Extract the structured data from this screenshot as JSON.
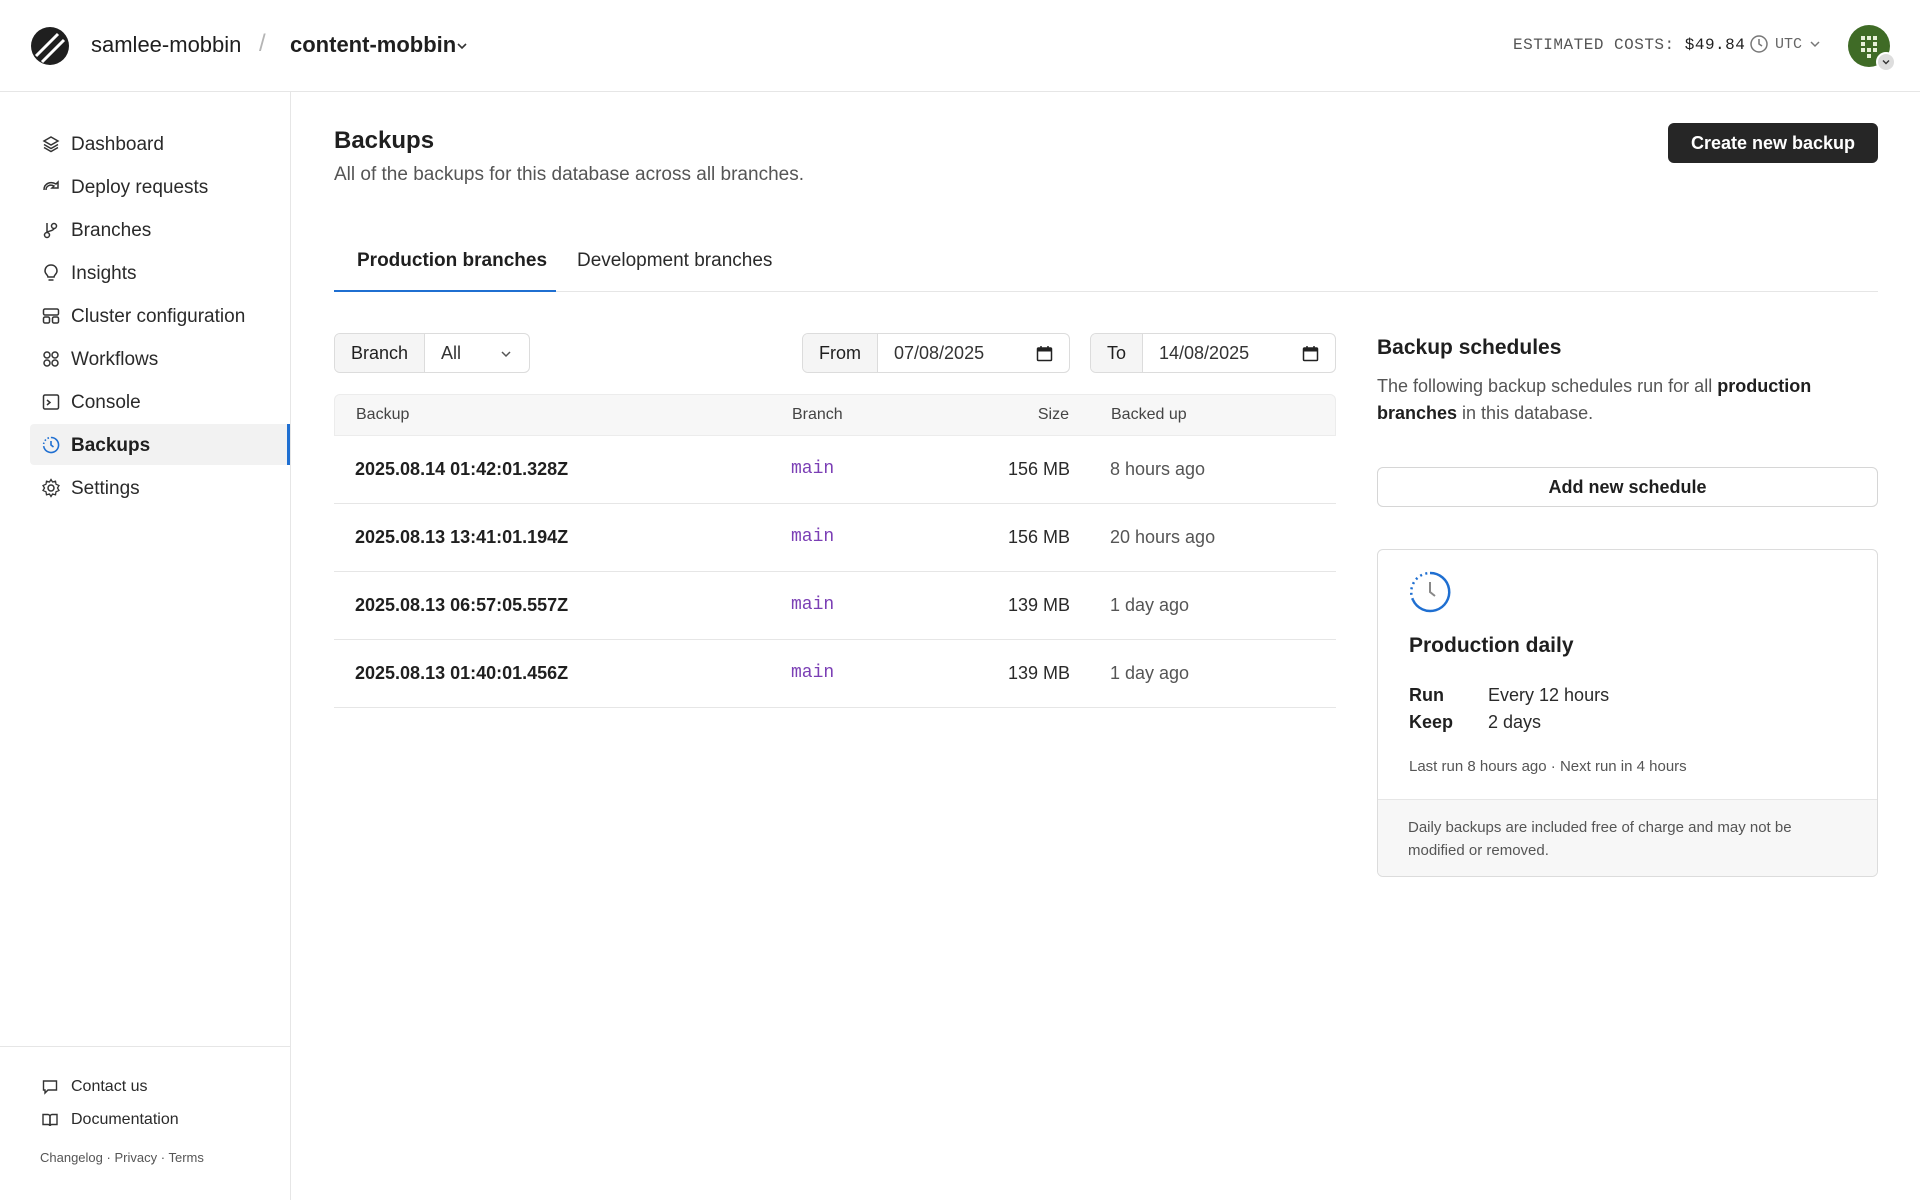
{
  "header": {
    "org": "samlee-mobbin",
    "separator": "/",
    "database": "content-mobbin",
    "costs_label": "ESTIMATED COSTS:",
    "costs_value": "$49.84",
    "timezone": "UTC"
  },
  "sidebar": {
    "items": [
      {
        "label": "Dashboard",
        "icon": "layers-icon"
      },
      {
        "label": "Deploy requests",
        "icon": "deploy-icon"
      },
      {
        "label": "Branches",
        "icon": "branch-icon"
      },
      {
        "label": "Insights",
        "icon": "lightbulb-icon"
      },
      {
        "label": "Cluster configuration",
        "icon": "cluster-icon"
      },
      {
        "label": "Workflows",
        "icon": "workflows-icon"
      },
      {
        "label": "Console",
        "icon": "terminal-icon"
      },
      {
        "label": "Backups",
        "icon": "backup-clock-icon",
        "active": true
      },
      {
        "label": "Settings",
        "icon": "gear-icon"
      }
    ],
    "footer": {
      "contact": "Contact us",
      "docs": "Documentation",
      "changelog": "Changelog",
      "privacy": "Privacy",
      "terms": "Terms",
      "dot": "·"
    }
  },
  "main": {
    "title": "Backups",
    "subtitle": "All of the backups for this database across all branches.",
    "create_button": "Create new backup",
    "tabs": [
      {
        "label": "Production branches",
        "active": true
      },
      {
        "label": "Development branches",
        "active": false
      }
    ],
    "filters": {
      "branch_label": "Branch",
      "branch_value": "All",
      "from_label": "From",
      "from_value": "07/08/2025",
      "to_label": "To",
      "to_value": "14/08/2025"
    },
    "table": {
      "columns": [
        "Backup",
        "Branch",
        "Size",
        "Backed up"
      ],
      "rows": [
        {
          "name": "2025.08.14 01:42:01.328Z",
          "branch": "main",
          "size": "156 MB",
          "age": "8 hours ago"
        },
        {
          "name": "2025.08.13 13:41:01.194Z",
          "branch": "main",
          "size": "156 MB",
          "age": "20 hours ago"
        },
        {
          "name": "2025.08.13 06:57:05.557Z",
          "branch": "main",
          "size": "139 MB",
          "age": "1 day ago"
        },
        {
          "name": "2025.08.13 01:40:01.456Z",
          "branch": "main",
          "size": "139 MB",
          "age": "1 day ago"
        }
      ]
    }
  },
  "schedules": {
    "title": "Backup schedules",
    "desc_pre": "The following backup schedules run for all ",
    "desc_bold": "production branches",
    "desc_post": " in this database.",
    "add_button": "Add new schedule",
    "card": {
      "title": "Production daily",
      "run_label": "Run",
      "run_value": "Every 12 hours",
      "keep_label": "Keep",
      "keep_value": "2 days",
      "last_run": "Last run 8 hours ago",
      "meta_sep": "·",
      "next_run": "Next run in 4 hours",
      "footer": "Daily backups are included free of charge and may not be modified or removed."
    }
  },
  "colors": {
    "accent": "#1f6fd1",
    "branch_text": "#7b3fb5",
    "primary_button": "#262626"
  }
}
